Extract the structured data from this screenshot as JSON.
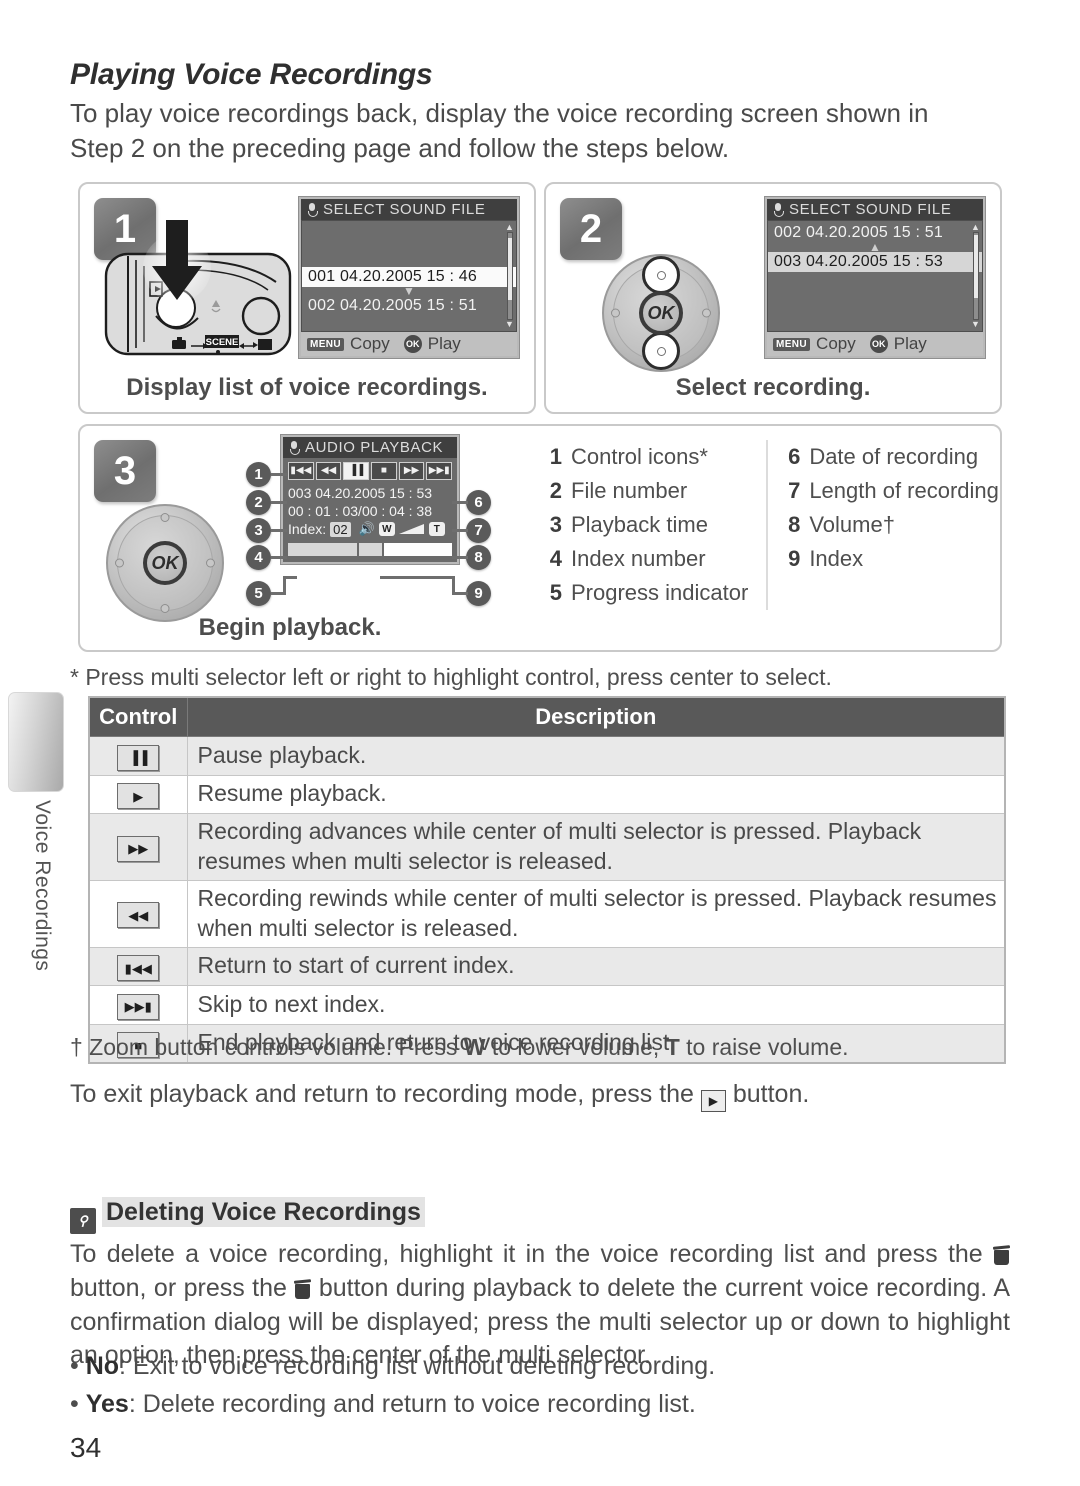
{
  "section": {
    "title": "Playing Voice Recordings",
    "intro_justified": "To play voice recordings back, display the voice recording screen shown in",
    "intro_last": "Step 2 on the preceding page and follow the steps below."
  },
  "steps": [
    {
      "number": "1",
      "caption": "Display list of voice recordings.",
      "screen": {
        "title": "SELECT SOUND FILE",
        "rows": [
          {
            "text": "001 04.20.2005  15 : 46",
            "state": "selected"
          },
          {
            "text": "002 04.20.2005  15 : 51",
            "state": "normal"
          }
        ],
        "arrow": "down",
        "footer": {
          "menu_key": "MENU",
          "menu_label": "Copy",
          "ok_key": "OK",
          "ok_label": "Play"
        }
      }
    },
    {
      "number": "2",
      "caption": "Select recording.",
      "screen": {
        "title": "SELECT SOUND FILE",
        "rows": [
          {
            "text": "002 04.20.2005  15 : 51",
            "state": "normal"
          },
          {
            "text": "003 04.20.2005  15 : 53",
            "state": "selected-dim"
          }
        ],
        "arrow": "up",
        "footer": {
          "menu_key": "MENU",
          "menu_label": "Copy",
          "ok_key": "OK",
          "ok_label": "Play"
        }
      }
    },
    {
      "number": "3",
      "caption": "Begin playback.",
      "screen": {
        "title": "AUDIO PLAYBACK",
        "controls": [
          {
            "glyph": "▮◀◀",
            "name": "prev-index",
            "active": false
          },
          {
            "glyph": "◀◀",
            "name": "rewind",
            "active": false
          },
          {
            "glyph": "▐▐",
            "name": "pause",
            "active": true
          },
          {
            "glyph": "■",
            "name": "stop",
            "active": false
          },
          {
            "glyph": "▶▶",
            "name": "fast-forward",
            "active": false
          },
          {
            "glyph": "▶▶▮",
            "name": "next-index",
            "active": false
          }
        ],
        "file_line": "003 04.20.2005   15 : 53",
        "time_line": "00 : 01 : 03/00 : 04 : 38",
        "index_label": "Index:",
        "index_value": "02",
        "volume_wide": "W",
        "volume_tele": "T"
      }
    }
  ],
  "callouts": {
    "left": [
      {
        "n": "1",
        "label": "Control icons*"
      },
      {
        "n": "2",
        "label": "File number"
      },
      {
        "n": "3",
        "label": "Playback time"
      },
      {
        "n": "4",
        "label": "Index number"
      },
      {
        "n": "5",
        "label": "Progress indicator"
      }
    ],
    "right": [
      {
        "n": "6",
        "label": "Date of recording"
      },
      {
        "n": "7",
        "label": "Length of recording"
      },
      {
        "n": "8",
        "label": "Volume†"
      },
      {
        "n": "9",
        "label": "Index"
      }
    ]
  },
  "footnote_star": "* Press multi selector left or right to highlight control, press center to select.",
  "table": {
    "headers": {
      "control": "Control",
      "description": "Description"
    },
    "rows": [
      {
        "icon": "▐▐",
        "icon_name": "pause-icon",
        "description": "Pause playback."
      },
      {
        "icon": "▶",
        "icon_name": "play-icon",
        "description": "Resume playback."
      },
      {
        "icon": "▶▶",
        "icon_name": "fast-forward-icon",
        "description": "Recording advances while center of multi selector is pressed.  Playback resumes when multi selector is released."
      },
      {
        "icon": "◀◀",
        "icon_name": "rewind-icon",
        "description": "Recording rewinds while center of multi selector is pressed.  Playback resumes when multi selector is released."
      },
      {
        "icon": "▮◀◀",
        "icon_name": "previous-index-icon",
        "description": "Return to start of current index."
      },
      {
        "icon": "▶▶▮",
        "icon_name": "next-index-icon",
        "description": "Skip to next index."
      },
      {
        "icon": "■",
        "icon_name": "stop-icon",
        "description": "End playback and return to voice recording list."
      }
    ]
  },
  "footnote_dagger_pre": "† Zoom button controls volume.  Press ",
  "footnote_dagger_w": "W",
  "footnote_dagger_mid": " to lower volume, ",
  "footnote_dagger_t": "T",
  "footnote_dagger_post": " to raise volume.",
  "exit_pre": "To exit playback and return to recording mode, press the ",
  "exit_post": " button.",
  "tip": {
    "title": "Deleting Voice Recordings",
    "para_1": "To delete a voice recording, highlight it in the voice recording list and press the ",
    "para_2": " button, or press the ",
    "para_3": " button during playback to delete the current voice recording.  A confirmation dialog will be displayed; press the multi selector up or down to highlight an option, then press the center of the multi selector.",
    "bullets": [
      {
        "marker": "• ",
        "term": "No",
        "text": ": Exit to voice recording list without deleting recording."
      },
      {
        "marker": "• ",
        "term": "Yes",
        "text": ": Delete recording and return to voice recording list."
      }
    ]
  },
  "side_tab_label": "Voice Recordings",
  "page_number": "34",
  "camera": {
    "scene_label": "SCENE"
  }
}
